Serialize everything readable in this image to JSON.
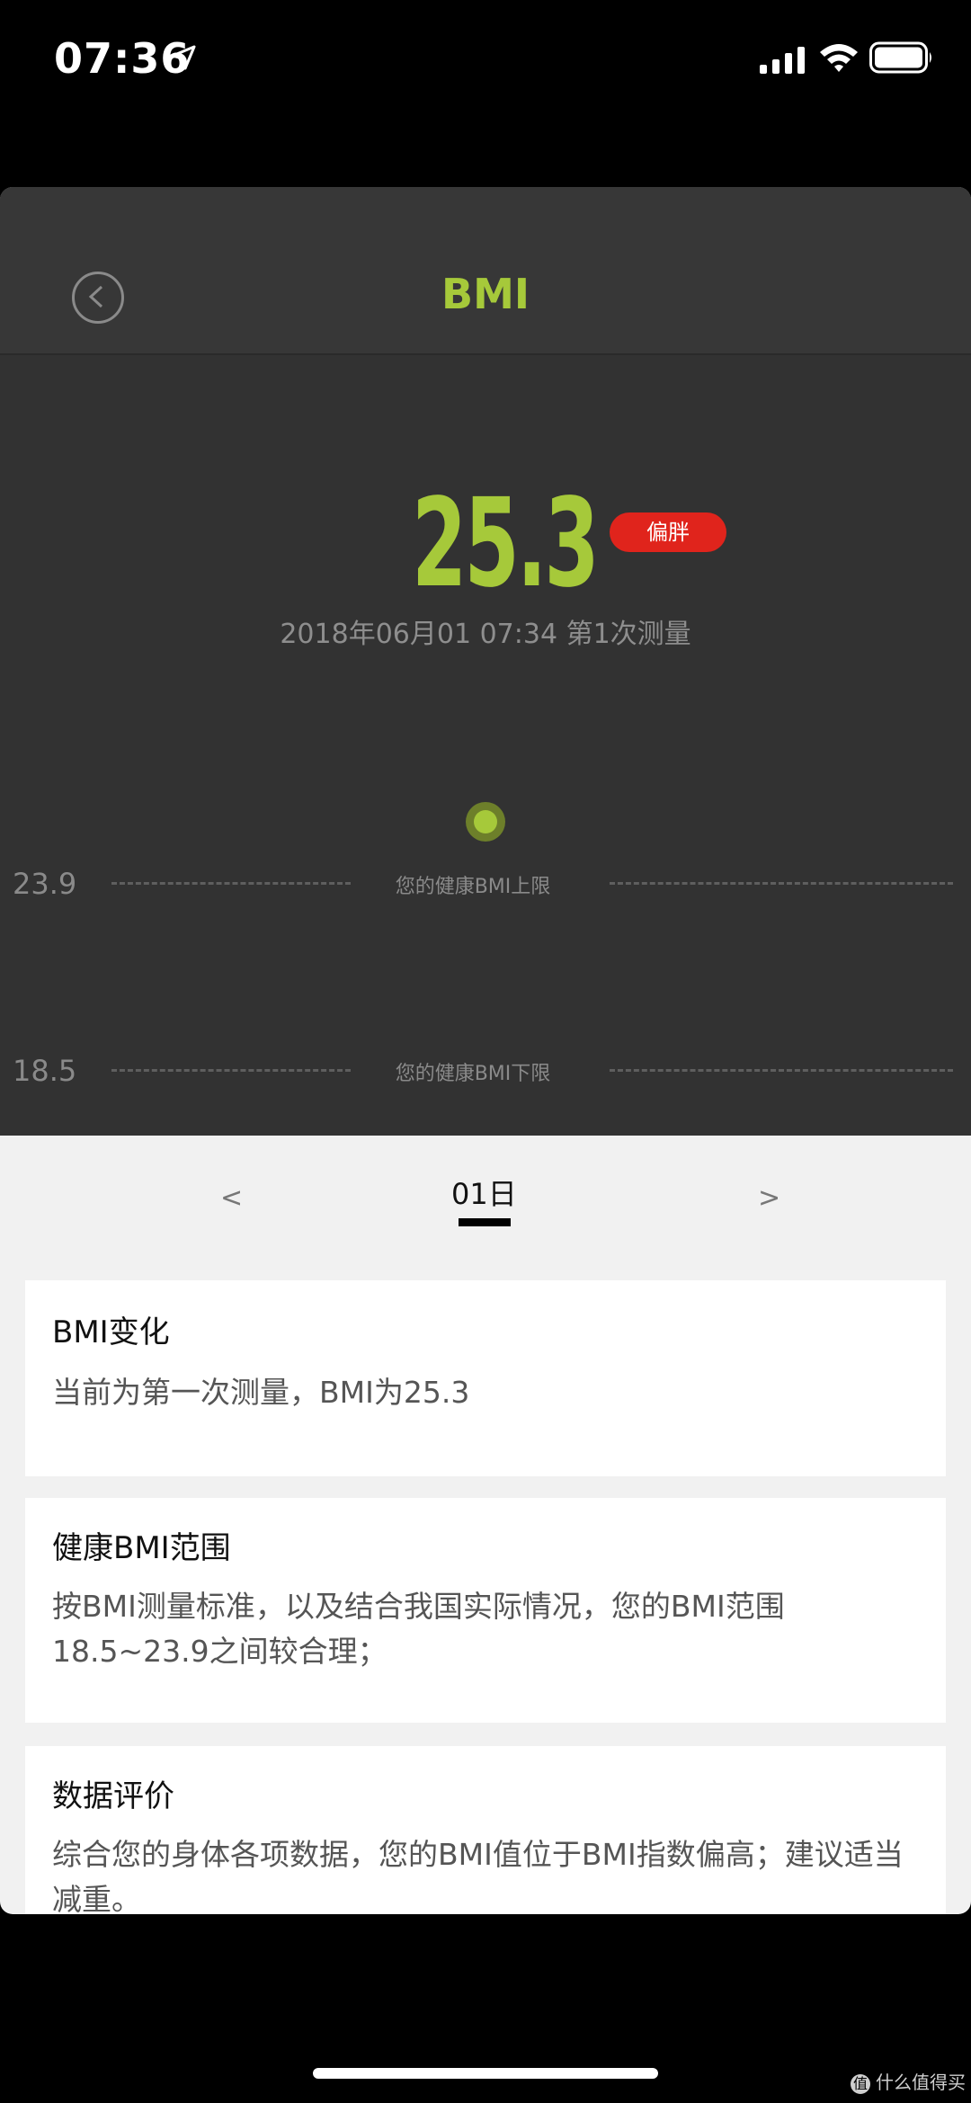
{
  "status_bar": {
    "time": "07:36"
  },
  "icons": [
    "location-arrow-icon",
    "signal-icon",
    "wifi-icon",
    "battery-icon",
    "back-icon"
  ],
  "nav": {
    "title": "BMI"
  },
  "summary": {
    "value": "25.3",
    "badge": "偏胖",
    "measure_info": "2018年06月01 07:34  第1次测量"
  },
  "chart": {
    "upper": {
      "value": "23.9",
      "label": "您的健康BMI上限"
    },
    "lower": {
      "value": "18.5",
      "label": "您的健康BMI下限"
    }
  },
  "date_tabs": {
    "prev": "<",
    "current": "01日",
    "next": ">"
  },
  "cards": [
    {
      "title": "BMI变化",
      "body": "当前为第一次测量，BMI为25.3"
    },
    {
      "title": "健康BMI范围",
      "body": "按BMI测量标准，以及结合我国实际情况，您的BMI范围18.5~23.9之间较合理；"
    },
    {
      "title": "数据评价",
      "body": "综合您的身体各项数据，您的BMI值位于BMI指数偏高；建议适当减重。"
    }
  ],
  "colors": {
    "accent": "#a6c93a",
    "badge": "#e0241c",
    "dark_bg": "#323232"
  },
  "watermark": {
    "logo": "值",
    "text": "什么值得买"
  }
}
